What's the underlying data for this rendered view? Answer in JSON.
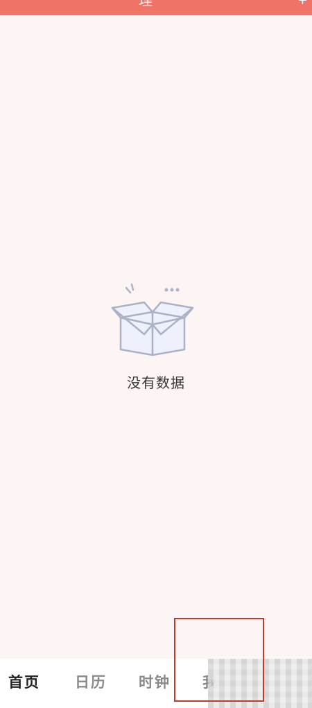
{
  "header": {
    "title": "理",
    "action": "+"
  },
  "empty_state": {
    "icon": "empty-box-icon",
    "message": "没有数据"
  },
  "bottom_nav": {
    "items": [
      {
        "label": "首页",
        "active": true
      },
      {
        "label": "日历",
        "active": false
      },
      {
        "label": "时钟",
        "active": false
      },
      {
        "label": "我",
        "active": false
      }
    ]
  },
  "colors": {
    "header_bg": "#f07368",
    "page_bg": "#fdf4f4",
    "highlight": "#c0392b",
    "icon_stroke": "#aab2c8",
    "icon_fill": "#eef1fb"
  }
}
